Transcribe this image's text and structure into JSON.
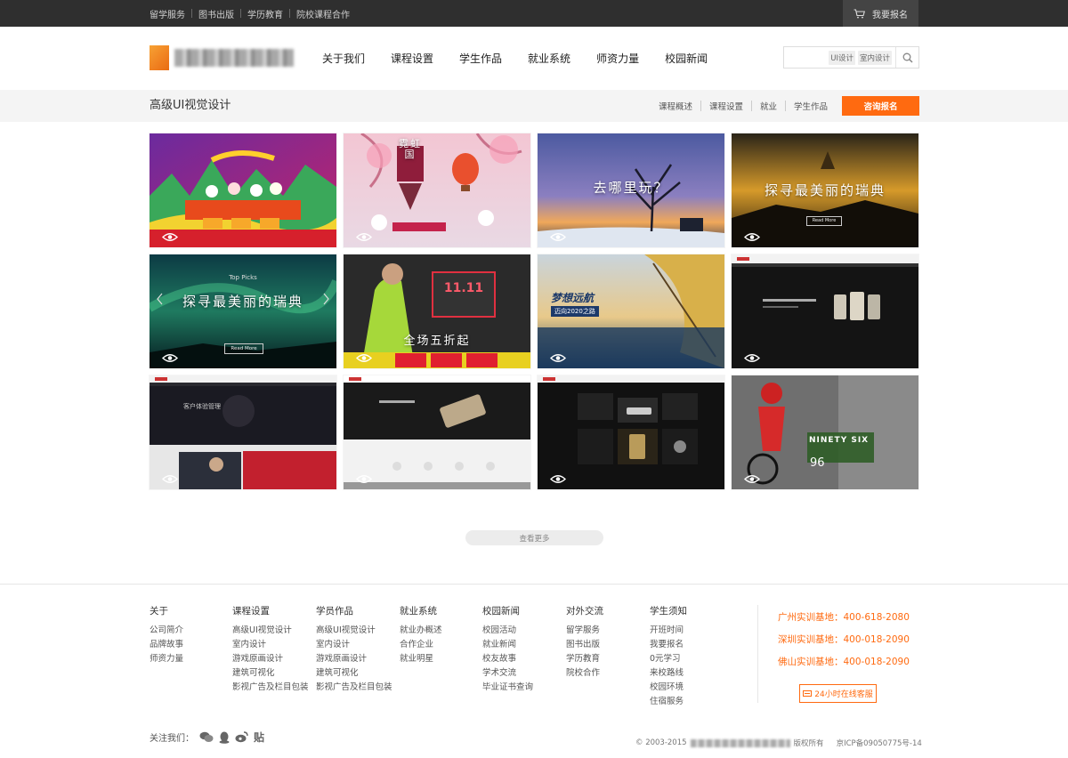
{
  "topbar": {
    "links": [
      "留学服务",
      "图书出版",
      "学历教育",
      "院校课程合作"
    ],
    "signup_label": "我要报名"
  },
  "header": {
    "nav": [
      "关于我们",
      "课程设置",
      "学生作品",
      "就业系统",
      "师资力量",
      "校园新闻"
    ],
    "search": {
      "tags": [
        "UI设计",
        "室内设计"
      ],
      "value": ""
    }
  },
  "subbar": {
    "title": "高级UI视觉设计",
    "links": [
      "课程概述",
      "课程设置",
      "就业",
      "学生作品"
    ],
    "consult_label": "咨询报名"
  },
  "gallery": {
    "items": [
      {
        "caption": ""
      },
      {
        "caption": "霓虹国"
      },
      {
        "caption": "去哪里玩？"
      },
      {
        "caption": "探寻最美丽的瑞典",
        "button": "Read More"
      },
      {
        "caption": "探寻最美丽的瑞典",
        "small": "Top Picks",
        "button": "Read More"
      },
      {
        "caption": "全场五折起",
        "small": "11.11"
      },
      {
        "caption": "梦想远航",
        "small": "迈向2020之路"
      },
      {
        "caption": ""
      },
      {
        "caption": "客户体验管理"
      },
      {
        "caption": ""
      },
      {
        "caption": ""
      },
      {
        "caption": "NINETY SIX",
        "small": "96"
      }
    ],
    "more_label": "查看更多"
  },
  "footer": {
    "columns": [
      {
        "title": "关于",
        "items": [
          "公司简介",
          "品牌故事",
          "师资力量"
        ]
      },
      {
        "title": "课程设置",
        "items": [
          "高级UI视觉设计",
          "室内设计",
          "游戏原画设计",
          "建筑可视化",
          "影视广告及栏目包装"
        ]
      },
      {
        "title": "学员作品",
        "items": [
          "高级UI视觉设计",
          "室内设计",
          "游戏原画设计",
          "建筑可视化",
          "影视广告及栏目包装"
        ]
      },
      {
        "title": "就业系统",
        "items": [
          "就业办概述",
          "合作企业",
          "就业明星"
        ]
      },
      {
        "title": "校园新闻",
        "items": [
          "校园活动",
          "就业新闻",
          "校友故事",
          "学术交流",
          "毕业证书查询"
        ]
      },
      {
        "title": "对外交流",
        "items": [
          "留学服务",
          "图书出版",
          "学历教育",
          "院校合作"
        ]
      },
      {
        "title": "学生须知",
        "items": [
          "开班时间",
          "我要报名",
          "0元学习",
          "来校路线",
          "校园环境",
          "住宿服务"
        ]
      }
    ],
    "hotlines": [
      "广州实训基地：400-618-2080",
      "深圳实训基地：400-018-2090",
      "佛山实训基地：400-018-2090"
    ],
    "online_label": "24小时在线客服",
    "follow_label": "关注我们：",
    "tieba_label": "贴",
    "copyright_prefix": "© 2003-2015",
    "copyright_suffix": "版权所有",
    "icp": "京ICP备09050775号-14"
  },
  "colors": {
    "accent": "#ff6a10",
    "topbar": "#2f2f2f",
    "subbar": "#f4f4f4"
  }
}
